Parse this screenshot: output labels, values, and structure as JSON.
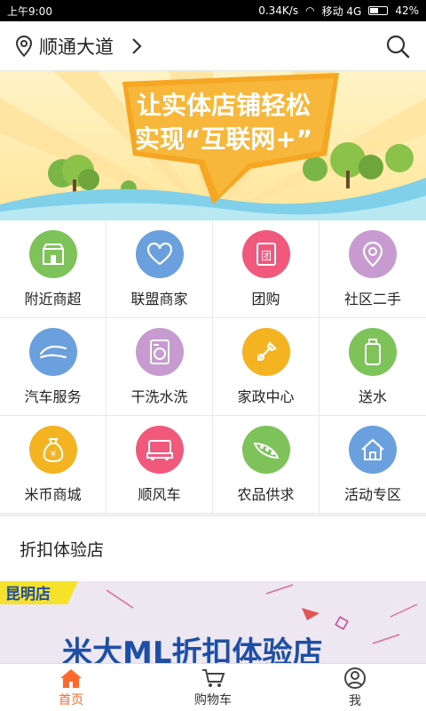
{
  "status_bar": {
    "time": "上午9:00",
    "net_speed": "0.34K/s",
    "carrier": "移动 4G",
    "battery": "42%"
  },
  "header": {
    "location": "顺通大道"
  },
  "banner": {
    "line1": "让实体店铺轻松",
    "line2": "实现“互联网+”"
  },
  "grid": [
    {
      "label": "附近商超",
      "icon": "store-icon",
      "color": "#7dc35a"
    },
    {
      "label": "联盟商家",
      "icon": "heart-icon",
      "color": "#6aa0de"
    },
    {
      "label": "团购",
      "icon": "group-buy-icon",
      "color": "#f0597c"
    },
    {
      "label": "社区二手",
      "icon": "location-pin-icon",
      "color": "#c79bd0"
    },
    {
      "label": "汽车服务",
      "icon": "car-service-icon",
      "color": "#6aa0de"
    },
    {
      "label": "干洗水洗",
      "icon": "washing-machine-icon",
      "color": "#c79bd0"
    },
    {
      "label": "家政中心",
      "icon": "tools-icon",
      "color": "#f4b321"
    },
    {
      "label": "送水",
      "icon": "water-bottle-icon",
      "color": "#7dc35a"
    },
    {
      "label": "米币商城",
      "icon": "money-bag-icon",
      "color": "#f4b321"
    },
    {
      "label": "顺风车",
      "icon": "car-icon",
      "color": "#f0597c"
    },
    {
      "label": "农品供求",
      "icon": "peas-icon",
      "color": "#7dc35a"
    },
    {
      "label": "活动专区",
      "icon": "house-icon",
      "color": "#6aa0de"
    }
  ],
  "section": {
    "title": "折扣体验店"
  },
  "promo": {
    "city": "昆明店",
    "text": "米大ML折扣体验店"
  },
  "tabs": [
    {
      "label": "首页",
      "icon": "home-icon",
      "active": true
    },
    {
      "label": "购物车",
      "icon": "cart-icon",
      "active": false
    },
    {
      "label": "我",
      "icon": "user-icon",
      "active": false
    }
  ]
}
